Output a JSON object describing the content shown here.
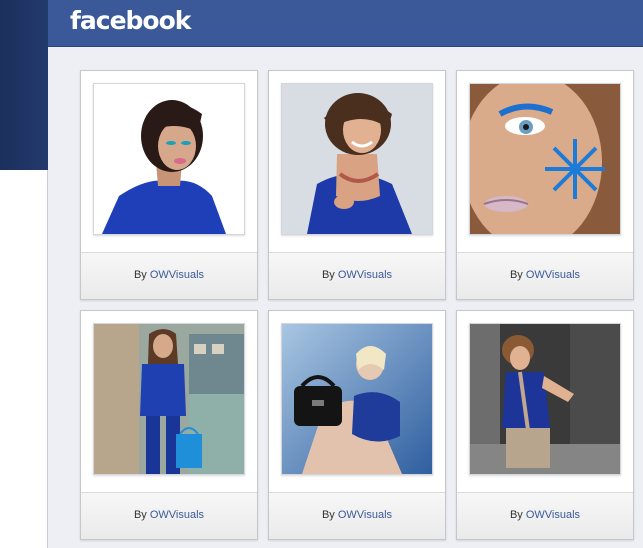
{
  "header": {
    "logo_text": "facebook"
  },
  "gallery": {
    "items": [
      {
        "by": "By",
        "author": "OWVisuals",
        "subject": "woman with bob haircut in blue"
      },
      {
        "by": "By",
        "author": "OWVisuals",
        "subject": "smiling woman in blue top"
      },
      {
        "by": "By",
        "author": "OWVisuals",
        "subject": "face with blue star makeup"
      },
      {
        "by": "By",
        "author": "OWVisuals",
        "subject": "woman in blue suit with bag"
      },
      {
        "by": "By",
        "author": "OWVisuals",
        "subject": "model in blue with black handbag"
      },
      {
        "by": "By",
        "author": "OWVisuals",
        "subject": "young man in blue shirt"
      }
    ]
  },
  "colors": {
    "brand_blue": "#3b5998",
    "link_blue": "#3b5998",
    "page_bg": "#edeff4",
    "left_panel": "#233a6e"
  }
}
